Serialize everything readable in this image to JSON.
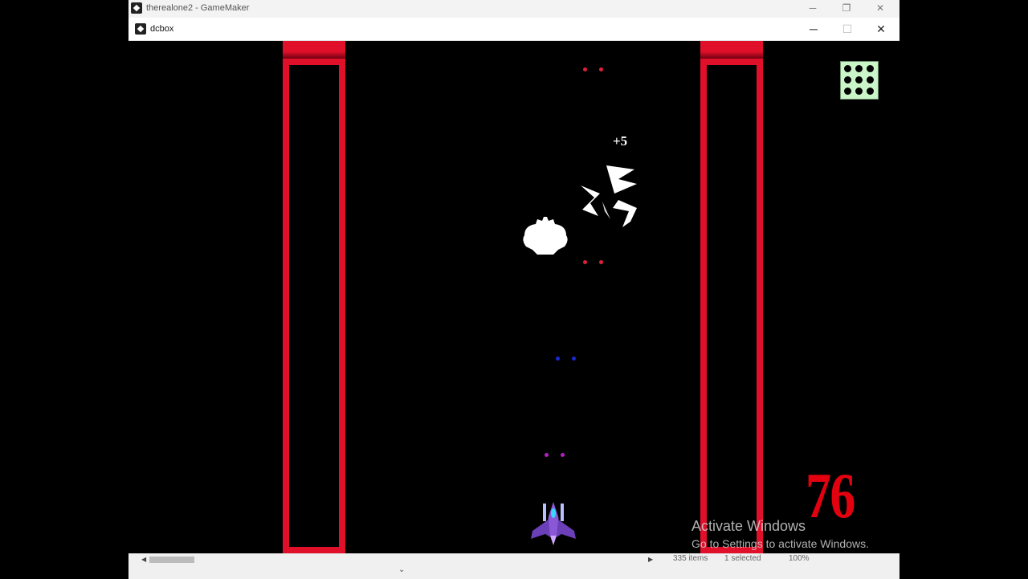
{
  "outer_window": {
    "title": "therealone2 - GameMaker",
    "controls": [
      "─",
      "❐",
      "✕"
    ]
  },
  "inner_window": {
    "title": "dcbox",
    "controls": [
      "─",
      "☐",
      "✕"
    ]
  },
  "game": {
    "bonus_text": "+5",
    "score": "76",
    "colors": {
      "wall": "#e0102a",
      "enemy_bullet": "#e0203a",
      "blue_bullet": "#1a2ad0",
      "player_bullet": "#b020c0",
      "hud_bg": "#c9f5c9"
    }
  },
  "watermark": {
    "title": "Activate Windows",
    "subtitle": "Go to Settings to activate Windows."
  },
  "statusbar": {
    "items": "335 items",
    "selected": "1 selected",
    "zoom": "100%"
  }
}
